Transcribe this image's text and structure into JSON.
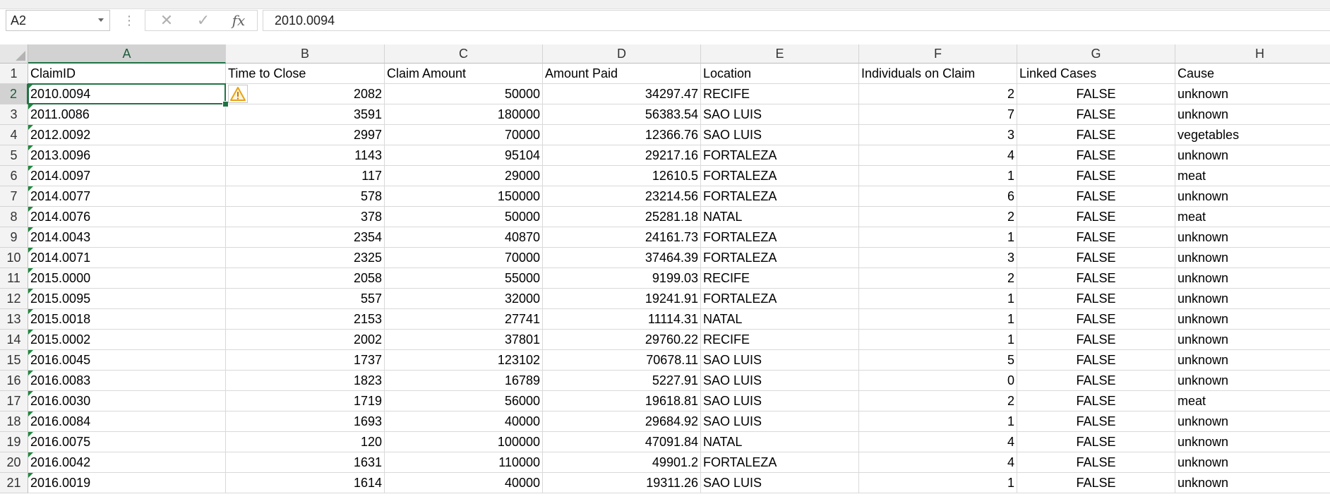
{
  "formula_bar": {
    "name_box": "A2",
    "formula": "2010.0094",
    "cancel_icon": "cancel-x-icon",
    "enter_icon": "enter-check-icon",
    "function_label": "fx"
  },
  "sheet": {
    "active_cell": "A2",
    "column_letters": [
      "A",
      "B",
      "C",
      "D",
      "E",
      "F",
      "G",
      "H"
    ],
    "headers": [
      "ClaimID",
      "Time to Close",
      "Claim Amount",
      "Amount Paid",
      "Location",
      "Individuals on Claim",
      "Linked Cases",
      "Cause"
    ],
    "rows": [
      [
        "2010.0094",
        "2082",
        "50000",
        "34297.47",
        "RECIFE",
        "2",
        "FALSE",
        "unknown"
      ],
      [
        "2011.0086",
        "3591",
        "180000",
        "56383.54",
        "SAO LUIS",
        "7",
        "FALSE",
        "unknown"
      ],
      [
        "2012.0092",
        "2997",
        "70000",
        "12366.76",
        "SAO LUIS",
        "3",
        "FALSE",
        "vegetables"
      ],
      [
        "2013.0096",
        "1143",
        "95104",
        "29217.16",
        "FORTALEZA",
        "4",
        "FALSE",
        "unknown"
      ],
      [
        "2014.0097",
        "117",
        "29000",
        "12610.5",
        "FORTALEZA",
        "1",
        "FALSE",
        "meat"
      ],
      [
        "2014.0077",
        "578",
        "150000",
        "23214.56",
        "FORTALEZA",
        "6",
        "FALSE",
        "unknown"
      ],
      [
        "2014.0076",
        "378",
        "50000",
        "25281.18",
        "NATAL",
        "2",
        "FALSE",
        "meat"
      ],
      [
        "2014.0043",
        "2354",
        "40870",
        "24161.73",
        "FORTALEZA",
        "1",
        "FALSE",
        "unknown"
      ],
      [
        "2014.0071",
        "2325",
        "70000",
        "37464.39",
        "FORTALEZA",
        "3",
        "FALSE",
        "unknown"
      ],
      [
        "2015.0000",
        "2058",
        "55000",
        "9199.03",
        "RECIFE",
        "2",
        "FALSE",
        "unknown"
      ],
      [
        "2015.0095",
        "557",
        "32000",
        "19241.91",
        "FORTALEZA",
        "1",
        "FALSE",
        "unknown"
      ],
      [
        "2015.0018",
        "2153",
        "27741",
        "11114.31",
        "NATAL",
        "1",
        "FALSE",
        "unknown"
      ],
      [
        "2015.0002",
        "2002",
        "37801",
        "29760.22",
        "RECIFE",
        "1",
        "FALSE",
        "unknown"
      ],
      [
        "2016.0045",
        "1737",
        "123102",
        "70678.11",
        "SAO LUIS",
        "5",
        "FALSE",
        "unknown"
      ],
      [
        "2016.0083",
        "1823",
        "16789",
        "5227.91",
        "SAO LUIS",
        "0",
        "FALSE",
        "unknown"
      ],
      [
        "2016.0030",
        "1719",
        "56000",
        "19618.81",
        "SAO LUIS",
        "2",
        "FALSE",
        "meat"
      ],
      [
        "2016.0084",
        "1693",
        "40000",
        "29684.92",
        "SAO LUIS",
        "1",
        "FALSE",
        "unknown"
      ],
      [
        "2016.0075",
        "120",
        "100000",
        "47091.84",
        "NATAL",
        "4",
        "FALSE",
        "unknown"
      ],
      [
        "2016.0042",
        "1631",
        "110000",
        "49901.2",
        "FORTALEZA",
        "4",
        "FALSE",
        "unknown"
      ],
      [
        "2016.0019",
        "1614",
        "40000",
        "19311.26",
        "SAO LUIS",
        "1",
        "FALSE",
        "unknown"
      ]
    ]
  },
  "colors": {
    "accent": "#217346",
    "error_triangle": "#1e8a3c",
    "warning": "#e8a317"
  }
}
